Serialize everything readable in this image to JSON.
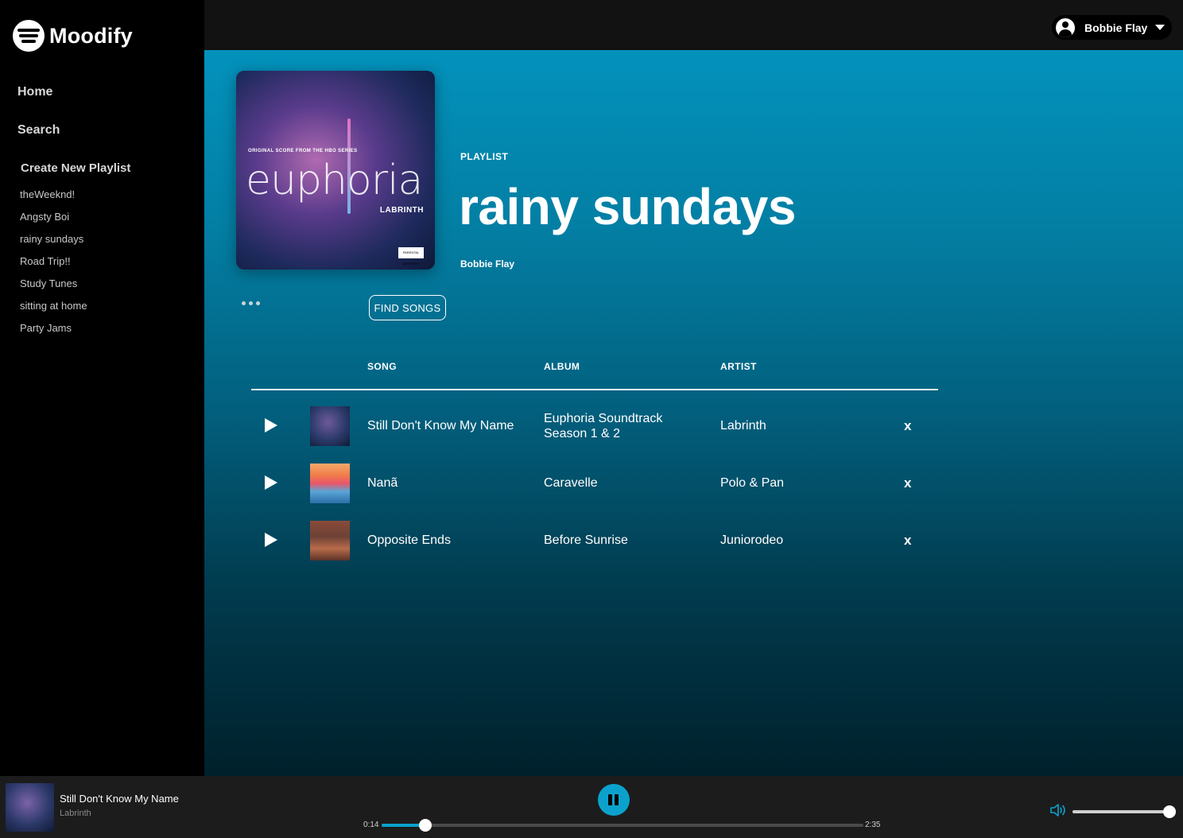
{
  "app": {
    "name": "Moodify"
  },
  "nav": {
    "home": "Home",
    "search": "Search",
    "create_playlist": "Create New Playlist"
  },
  "sidebar": {
    "playlists": [
      "theWeeknd!",
      "Angsty Boi",
      "rainy sundays",
      "Road Trip!!",
      "Study Tunes",
      "sitting at home",
      "Party Jams"
    ]
  },
  "user": {
    "name": "Bobbie Flay"
  },
  "playlist": {
    "type_label": "PLAYLIST",
    "title": "rainy sundays",
    "owner": "Bobbie Flay",
    "cover": {
      "score_line": "ORIGINAL SCORE FROM THE HBO SERIES",
      "title": "euphoria",
      "artist": "LABRINTH",
      "badge": "PARENTAL ADVISORY EXPLICIT CONTENT"
    }
  },
  "actions": {
    "more_icon": "more-dots-icon",
    "find_songs": "FIND SONGS"
  },
  "table": {
    "headers": {
      "song": "SONG",
      "album": "ALBUM",
      "artist": "ARTIST"
    },
    "remove_label": "x",
    "tracks": [
      {
        "song": "Still Don't Know My Name",
        "album": "Euphoria Soundtrack Season 1 & 2",
        "artist": "Labrinth"
      },
      {
        "song": "Nanã",
        "album": "Caravelle",
        "artist": "Polo & Pan"
      },
      {
        "song": "Opposite Ends",
        "album": "Before Sunrise",
        "artist": "Juniorodeo"
      }
    ]
  },
  "player": {
    "track_title": "Still Don't Know My Name",
    "track_artist": "Labrinth",
    "current_time": "0:14",
    "total_time": "2:35",
    "progress_fraction": 0.09,
    "volume_fraction": 1.0,
    "is_playing": true
  },
  "colors": {
    "accent": "#0aa2cc",
    "gradient_top": "#0392bc",
    "gradient_bottom": "#00202b"
  }
}
